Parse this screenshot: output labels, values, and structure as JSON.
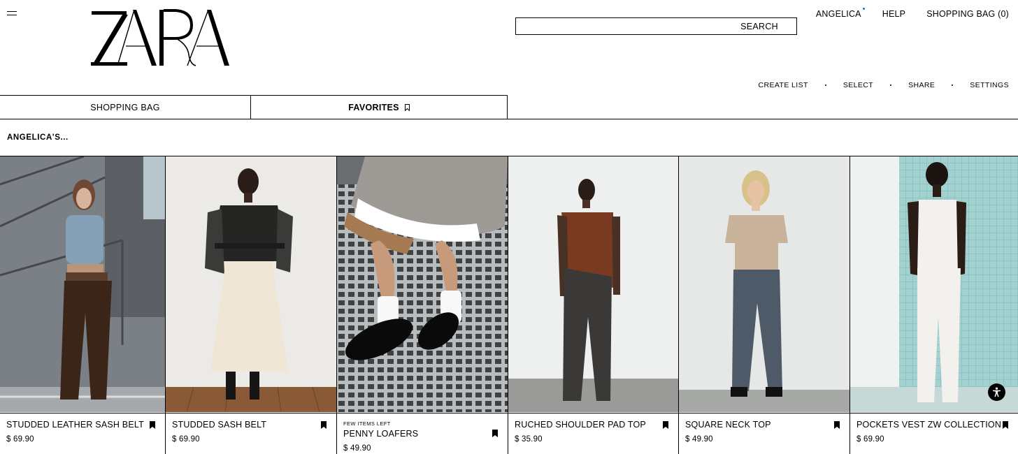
{
  "header": {
    "logo_text": "ZARA",
    "search_label": "SEARCH",
    "nav": {
      "user": "ANGELICA",
      "help": "HELP",
      "bag": "SHOPPING BAG (0)"
    }
  },
  "actions": {
    "create_list": "CREATE LIST",
    "select": "SELECT",
    "share": "SHARE",
    "settings": "SETTINGS"
  },
  "tabs": {
    "shopping_bag": "SHOPPING BAG",
    "favorites": "FAVORITES"
  },
  "list_title": "ANGELICA'S...",
  "products": [
    {
      "name": "STUDDED LEATHER SASH BELT",
      "price": "$ 69.90",
      "badge": ""
    },
    {
      "name": "STUDDED SASH BELT",
      "price": "$ 69.90",
      "badge": ""
    },
    {
      "name": "PENNY LOAFERS",
      "price": "$ 49.90",
      "badge": "FEW ITEMS LEFT"
    },
    {
      "name": "RUCHED SHOULDER PAD TOP",
      "price": "$ 35.90",
      "badge": ""
    },
    {
      "name": "SQUARE NECK TOP",
      "price": "$ 49.90",
      "badge": ""
    },
    {
      "name": "POCKETS VEST ZW COLLECTION",
      "price": "$ 69.90",
      "badge": ""
    }
  ],
  "colors": {
    "accent_dot": "#1e6fd9",
    "text": "#000000",
    "background": "#ffffff"
  },
  "icons": {
    "menu": "hamburger-icon",
    "bookmark": "bookmark-icon",
    "accessibility": "accessibility-icon"
  }
}
